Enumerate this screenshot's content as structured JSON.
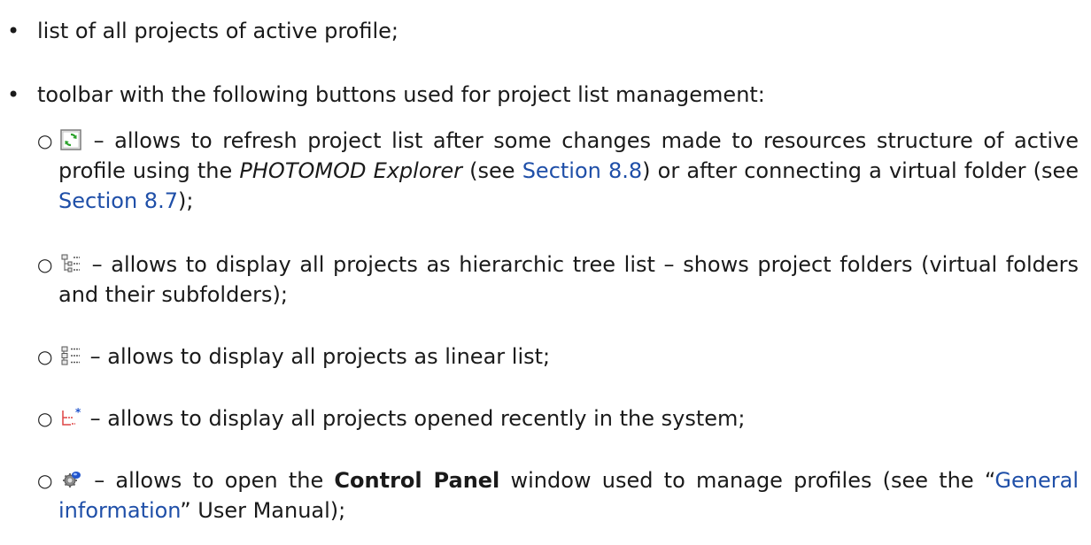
{
  "bullets": [
    {
      "text": "list of all projects of active profile;"
    },
    {
      "text": "toolbar with the following buttons used for project list management:"
    }
  ],
  "sub_items": [
    {
      "icon": "refresh-icon",
      "pre": " – allows to refresh project list after some changes made to resources structure of active profile using the ",
      "em": "PHOTOMOD Explorer",
      "mid1": " (see ",
      "link1": "Section 8.8",
      "mid2": ") or after connecting a virtual folder (see ",
      "link2": "Section 8.7",
      "post": ");"
    },
    {
      "icon": "tree-list-icon",
      "text": " – allows to display all projects as hierarchic tree list – shows project folders (virtual folders and their subfolders);"
    },
    {
      "icon": "linear-list-icon",
      "text": " – allows to display all projects as linear list;"
    },
    {
      "icon": "recent-projects-icon",
      "text": " – allows to display all projects opened recently in the system;"
    },
    {
      "icon": "control-panel-icon",
      "pre": " – allows to open the ",
      "strong": "Control Panel",
      "mid": " window used to manage profiles (see the “",
      "link": "General information",
      "post": "” User Manual);"
    }
  ],
  "colors": {
    "link": "#1f4fa8",
    "text": "#1a1a1a"
  }
}
